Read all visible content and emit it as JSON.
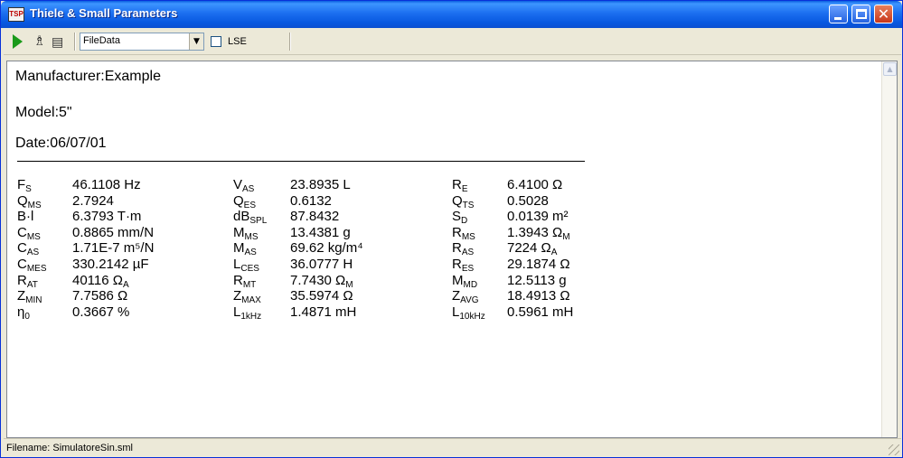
{
  "window": {
    "title": "Thiele & Small Parameters",
    "app_icon_text": "TSP"
  },
  "toolbar": {
    "combo_value": "FileData",
    "checkbox_label": "LSE",
    "checkbox_checked": false
  },
  "header": {
    "manufacturer": "Manufacturer:Example",
    "model": "Model:5\"",
    "date": "Date:06/07/01"
  },
  "params": [
    {
      "main": "F",
      "sub": "S",
      "value": "46.1108 Hz"
    },
    {
      "main": "Q",
      "sub": "MS",
      "value": "2.7924"
    },
    {
      "main": "B·l",
      "sub": "",
      "value": "6.3793 T·m"
    },
    {
      "main": "C",
      "sub": "MS",
      "value": "0.8865 mm/N"
    },
    {
      "main": "C",
      "sub": "AS",
      "value": "1.71E-7 m⁵/N"
    },
    {
      "main": "C",
      "sub": "MES",
      "value": "330.2142 µF"
    },
    {
      "main": "R",
      "sub": "AT",
      "value": "40116 Ω_A"
    },
    {
      "main": "Z",
      "sub": "MIN",
      "value": "7.7586 Ω"
    },
    {
      "main": "η",
      "sub": "0",
      "value": "0.3667 %"
    },
    {
      "main": "V",
      "sub": "AS",
      "value": "23.8935 L"
    },
    {
      "main": "Q",
      "sub": "ES",
      "value": "0.6132"
    },
    {
      "main": "dB",
      "sub": "SPL",
      "value": "87.8432"
    },
    {
      "main": "M",
      "sub": "MS",
      "value": "13.4381 g"
    },
    {
      "main": "M",
      "sub": "AS",
      "value": "69.62 kg/m⁴"
    },
    {
      "main": "L",
      "sub": "CES",
      "value": "36.0777 H"
    },
    {
      "main": "R",
      "sub": "MT",
      "value": "7.7430 Ω_M"
    },
    {
      "main": "Z",
      "sub": "MAX",
      "value": "35.5974 Ω"
    },
    {
      "main": "L",
      "sub": "1kHz",
      "value": "1.4871 mH"
    },
    {
      "main": "R",
      "sub": "E",
      "value": "6.4100 Ω"
    },
    {
      "main": "Q",
      "sub": "TS",
      "value": "0.5028"
    },
    {
      "main": "S",
      "sub": "D",
      "value": "0.0139 m²"
    },
    {
      "main": "R",
      "sub": "MS",
      "value": "1.3943 Ω_M"
    },
    {
      "main": "R",
      "sub": "AS",
      "value": "7224 Ω_A"
    },
    {
      "main": "R",
      "sub": "ES",
      "value": "29.1874 Ω"
    },
    {
      "main": "M",
      "sub": "MD",
      "value": "12.5113 g"
    },
    {
      "main": "Z",
      "sub": "AVG",
      "value": "18.4913 Ω"
    },
    {
      "main": "L",
      "sub": "10kHz",
      "value": "0.5961 mH"
    }
  ],
  "status": {
    "filename": "Filename: SimulatoreSin.sml"
  }
}
